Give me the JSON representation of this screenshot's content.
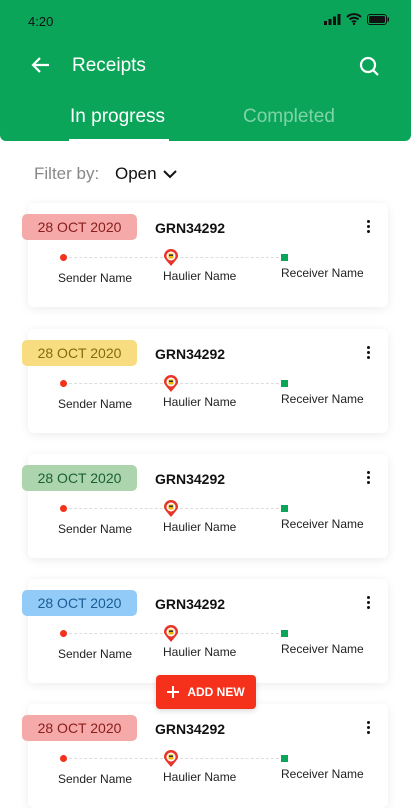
{
  "status_bar": {
    "time": "4:20"
  },
  "header": {
    "title": "Receipts"
  },
  "tabs": [
    {
      "label": "In progress",
      "active": true
    },
    {
      "label": "Completed",
      "active": false
    }
  ],
  "filter": {
    "label": "Filter by:",
    "value": "Open"
  },
  "colors": {
    "primary": "#0ba55a",
    "accent": "#f5301b"
  },
  "receipts": [
    {
      "date": "28 OCT 2020",
      "id": "GRN34292",
      "sender": "Sender Name",
      "haulier": "Haulier Name",
      "receiver": "Receiver Name",
      "badge_bg": "#f5a9a9",
      "badge_fg": "#8b1c1c"
    },
    {
      "date": "28 OCT 2020",
      "id": "GRN34292",
      "sender": "Sender Name",
      "haulier": "Haulier Name",
      "receiver": "Receiver Name",
      "badge_bg": "#f8dc80",
      "badge_fg": "#866a10"
    },
    {
      "date": "28 OCT 2020",
      "id": "GRN34292",
      "sender": "Sender Name",
      "haulier": "Haulier Name",
      "receiver": "Receiver Name",
      "badge_bg": "#acd5ae",
      "badge_fg": "#1b6035"
    },
    {
      "date": "28 OCT 2020",
      "id": "GRN34292",
      "sender": "Sender Name",
      "haulier": "Haulier Name",
      "receiver": "Receiver Name",
      "badge_bg": "#92cbf7",
      "badge_fg": "#1a5c96"
    },
    {
      "date": "28 OCT 2020",
      "id": "GRN34292",
      "sender": "Sender Name",
      "haulier": "Haulier Name",
      "receiver": "Receiver Name",
      "badge_bg": "#f5a9a9",
      "badge_fg": "#8b1c1c"
    }
  ],
  "fab": {
    "label": "ADD NEW"
  }
}
